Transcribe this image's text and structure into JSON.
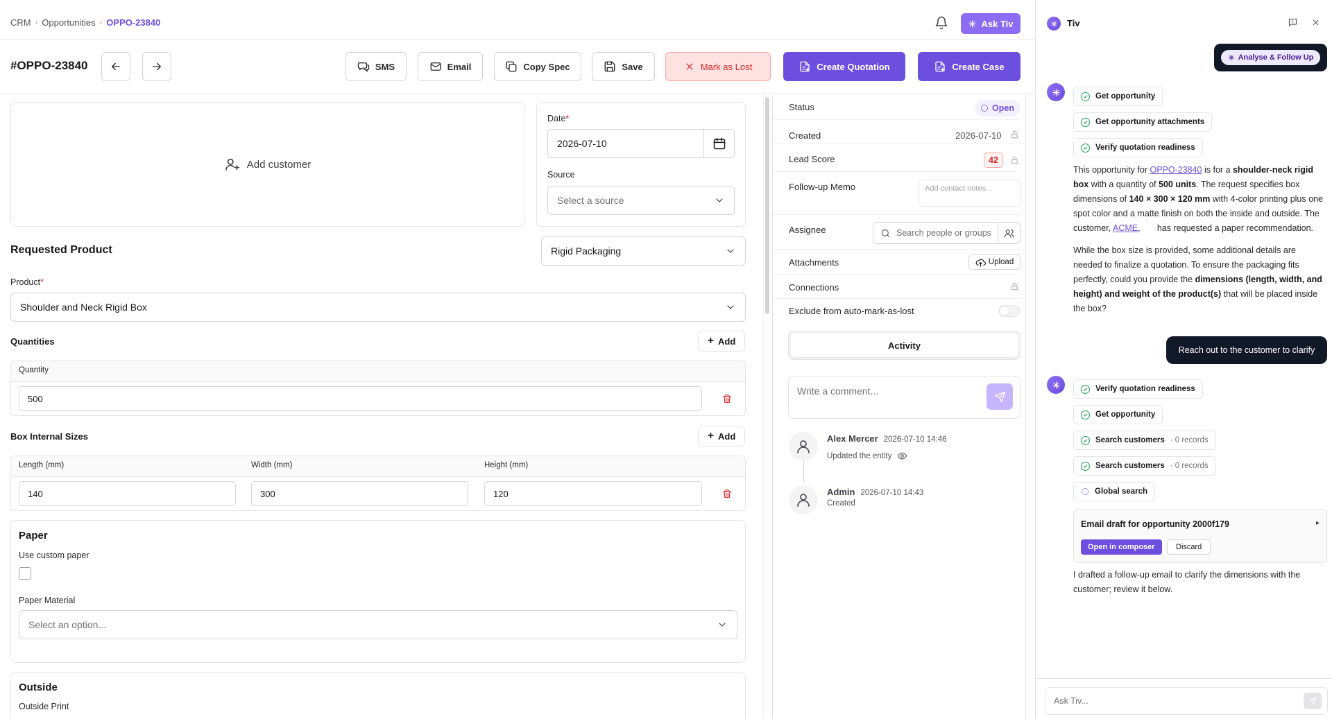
{
  "breadcrumb": {
    "root": "CRM",
    "section": "Opportunities",
    "current": "OPPO-23840"
  },
  "header": {
    "ask_label": "Ask Tiv",
    "opp_id": "#OPPO-23840"
  },
  "toolbar": {
    "sms": "SMS",
    "email": "Email",
    "copy_spec": "Copy Spec",
    "save": "Save",
    "mark_lost": "Mark as Lost",
    "create_quotation": "Create Quotation",
    "create_case": "Create Case"
  },
  "customer": {
    "add_label": "Add customer"
  },
  "date": {
    "label": "Date",
    "value": "2026-07-10"
  },
  "source": {
    "label": "Source",
    "placeholder": "Select a source"
  },
  "requested_product": {
    "title": "Requested Product",
    "category": "Rigid Packaging",
    "product_label": "Product",
    "product_value": "Shoulder and Neck Rigid Box"
  },
  "quantities": {
    "title": "Quantities",
    "add": "Add",
    "col": "Quantity",
    "value": "500"
  },
  "box_sizes": {
    "title": "Box Internal Sizes",
    "add": "Add",
    "length_label": "Length (mm)",
    "width_label": "Width (mm)",
    "height_label": "Height (mm)",
    "length": "140",
    "width": "300",
    "height": "120"
  },
  "paper": {
    "title": "Paper",
    "custom_label": "Use custom paper",
    "material_label": "Paper Material",
    "material_placeholder": "Select an option..."
  },
  "outside": {
    "title": "Outside",
    "print_label": "Outside Print"
  },
  "details": {
    "status_label": "Status",
    "status_value": "Open",
    "created_label": "Created",
    "created_value": "2026-07-10",
    "lead_label": "Lead Score",
    "lead_value": "42",
    "memo_label": "Follow-up Memo",
    "memo_placeholder": "Add contact notes...",
    "assignee_label": "Assignee",
    "assignee_placeholder": "Search people or groups",
    "attachments_label": "Attachments",
    "upload": "Upload",
    "connections_label": "Connections",
    "exclude_label": "Exclude from auto-mark-as-lost",
    "activity_tab": "Activity",
    "comment_placeholder": "Write a comment..."
  },
  "activity": [
    {
      "name": "Alex Mercer",
      "time": "2026-07-10 14:46",
      "text": "Updated the entity"
    },
    {
      "name": "Admin",
      "time": "2026-07-10 14:43",
      "text": "Created"
    }
  ],
  "chat": {
    "title": "Tiv",
    "action_chip": "Analyse & Follow Up",
    "steps1": [
      "Get opportunity",
      "Get opportunity attachments",
      "Verify quotation readiness"
    ],
    "msg1": {
      "p1_a": "This opportunity for ",
      "p1_link": "OPPO-23840",
      "p1_b": " is for a ",
      "p1_bold1": "shoulder-neck rigid box",
      "p1_c": " with a quantity of ",
      "p1_bold2": "500 units",
      "p1_d": ". The request specifies box dimensions of ",
      "p1_bold3": "140 × 300 × 120 mm",
      "p1_e": " with 4-color printing plus one spot color and a matte finish on both the inside and outside. The customer, ",
      "p1_link2": "ACME",
      "p1_f": ",       has requested a paper recommendation.",
      "p2_a": "While the box size is provided, some additional details are needed to finalize a quotation. To ensure the packaging fits perfectly, could you provide the ",
      "p2_bold": "dimensions (length, width, and height) and weight of the product(s)",
      "p2_b": " that will be placed inside the box?"
    },
    "user_msg": "Reach out to the customer to clarify",
    "steps2": [
      {
        "label": "Verify quotation readiness",
        "recs": ""
      },
      {
        "label": "Get opportunity",
        "recs": ""
      },
      {
        "label": "Search customers",
        "recs": "· 0 records"
      },
      {
        "label": "Search customers",
        "recs": "· 0 records"
      },
      {
        "label": "Global search",
        "recs": ""
      }
    ],
    "draft_title": "Email draft for opportunity 2000f179",
    "open_composer": "Open in composer",
    "discard": "Discard",
    "final_msg": "I drafted a follow-up email to clarify the dimensions with the customer; review it below.",
    "input_placeholder": "Ask Tiv..."
  },
  "colors": {
    "accent": "#6d4fe0",
    "danger": "#dc2626",
    "success": "#16a34a"
  }
}
